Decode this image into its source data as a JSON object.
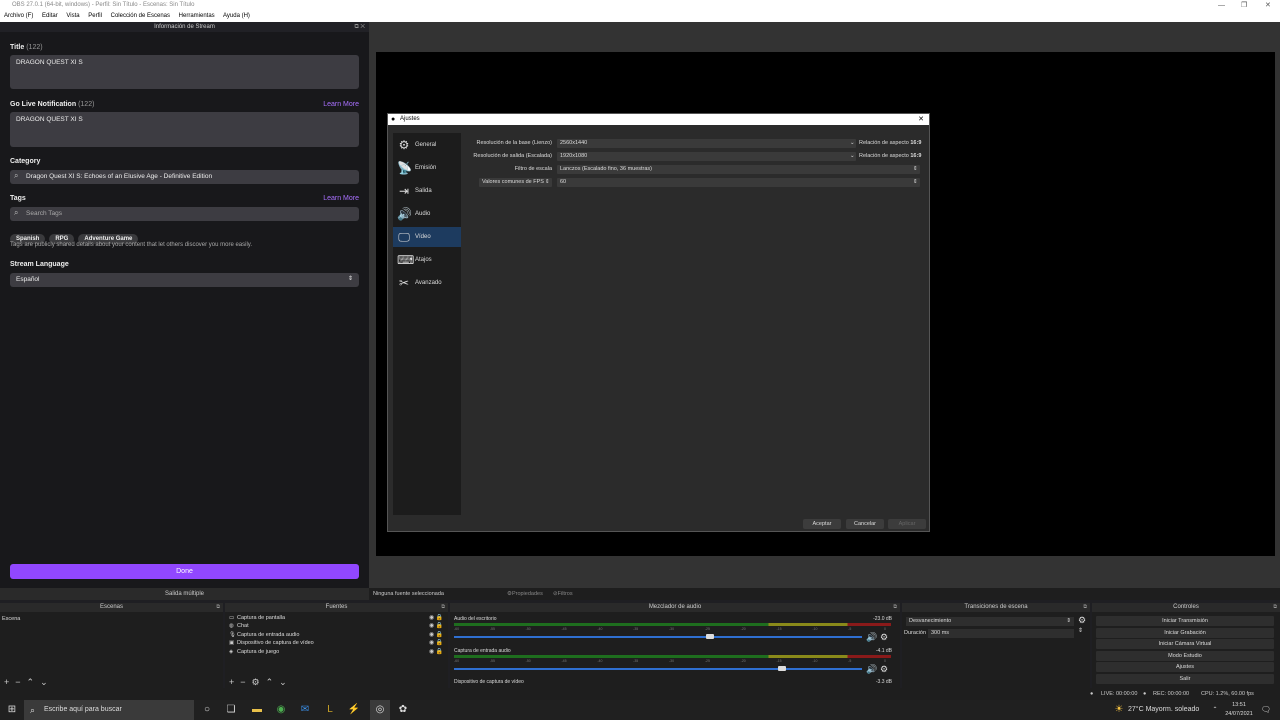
{
  "window": {
    "title": "OBS 27.0.1 (64-bit, windows) - Perfil: Sin Título - Escenas: Sin Título"
  },
  "menu": [
    "Archivo (F)",
    "Editar",
    "Vista",
    "Perfil",
    "Colección de Escenas",
    "Herramientas",
    "Ayuda (H)"
  ],
  "stream_info": {
    "dock_title": "Información de Stream",
    "title_label": "Title",
    "title_count": "(122)",
    "title_value": "DRAGON QUEST XI S",
    "notif_label": "Go Live Notification",
    "notif_count": "(122)",
    "notif_value": "DRAGON QUEST XI S",
    "learn_more": "Learn More",
    "category_label": "Category",
    "category_value": "Dragon Quest XI S: Echoes of an Elusive Age - Definitive Edition",
    "tags_label": "Tags",
    "tags_learn_more": "Learn More",
    "tags_placeholder": "Search Tags",
    "tags": [
      "Spanish",
      "RPG",
      "Adventure Game"
    ],
    "tags_hint": "Tags are publicly shared details about your content that let others discover you more easily.",
    "language_label": "Stream Language",
    "language_value": "Español",
    "done": "Done"
  },
  "settings": {
    "title": "Ajustes",
    "sidebar": [
      {
        "label": "General",
        "icon": "gear-icon"
      },
      {
        "label": "Emisión",
        "icon": "broadcast-icon"
      },
      {
        "label": "Salida",
        "icon": "output-icon"
      },
      {
        "label": "Audio",
        "icon": "speaker-icon"
      },
      {
        "label": "Vídeo",
        "icon": "monitor-icon"
      },
      {
        "label": "Atajos",
        "icon": "keyboard-icon"
      },
      {
        "label": "Avanzado",
        "icon": "tools-icon"
      }
    ],
    "selected": "Vídeo",
    "rows": [
      {
        "label": "Resolución de la base (Lienzo)",
        "value": "2560x1440",
        "aspect_label": "Relación de aspecto",
        "aspect": "16:9"
      },
      {
        "label": "Resolución de salida (Escalada)",
        "value": "1920x1080",
        "aspect_label": "Relación de aspecto",
        "aspect": "16:9"
      },
      {
        "label": "Filtro de escala",
        "value": "Lanczos (Escalado fino, 36 muestras)"
      },
      {
        "label": "Valores comunes de FPS",
        "value": "60"
      }
    ],
    "buttons": {
      "ok": "Aceptar",
      "cancel": "Cancelar",
      "apply": "Aplicar"
    }
  },
  "bottom": {
    "multi_output": "Salida múltiple",
    "no_source": "Ninguna fuente seleccionada",
    "properties": "Propiedades",
    "filters": "Filtros",
    "scenes": {
      "title": "Escenas",
      "items": [
        "Escena"
      ]
    },
    "sources": {
      "title": "Fuentes",
      "items": [
        "Captura de pantalla",
        "Chat",
        "Captura de entrada audio",
        "Dispositivo de captura de vídeo",
        "Captura de juego"
      ]
    },
    "mixer": {
      "title": "Mezclador de audio",
      "channels": [
        {
          "name": "Audio del escritorio",
          "db": "-23.0 dB",
          "level": 0.63
        },
        {
          "name": "Captura de entrada audio",
          "db": "-4.1 dB",
          "level": 0.81
        },
        {
          "name": "Dispositivo de captura de vídeo",
          "db": "-3.3 dB"
        }
      ],
      "ticks": [
        "-60",
        "-55",
        "-50",
        "-45",
        "-40",
        "-35",
        "-30",
        "-25",
        "-20",
        "-15",
        "-10",
        "-5",
        "0"
      ]
    },
    "transitions": {
      "title": "Transiciones de escena",
      "type": "Desvanecimiento",
      "duration_label": "Duración",
      "duration": "300 ms"
    },
    "controls": {
      "title": "Controles",
      "buttons": [
        "Iniciar Transmisión",
        "Iniciar Grabación",
        "Iniciar Cámara Virtual",
        "Modo Estudio",
        "Ajustes",
        "Salir"
      ]
    }
  },
  "status": {
    "live": "LIVE: 00:00:00",
    "rec": "REC: 00:00:00",
    "cpu": "CPU: 1.2%, 60.00 fps"
  },
  "taskbar": {
    "search_placeholder": "Escribe aquí para buscar",
    "weather": "27°C  Mayorm. soleado",
    "time": "13:51",
    "date": "24/07/2021"
  }
}
